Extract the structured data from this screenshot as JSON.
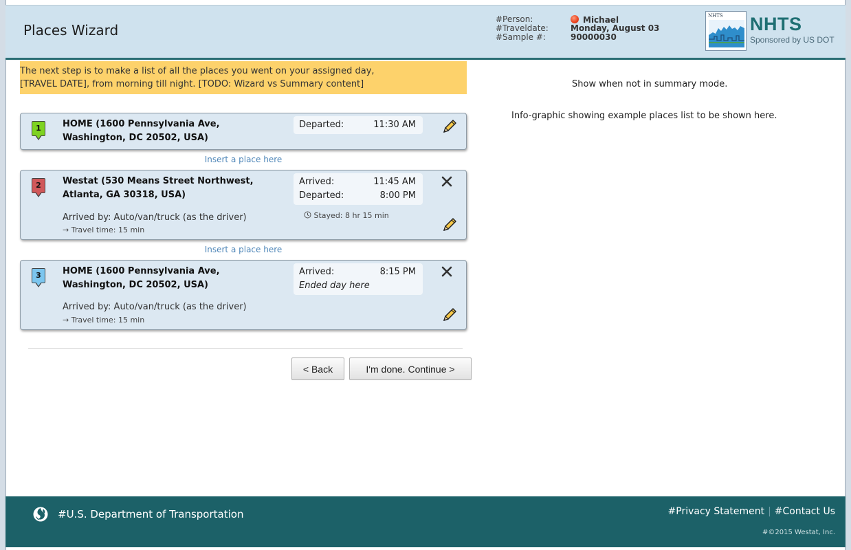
{
  "header": {
    "title": "Places Wizard",
    "meta_labels": [
      "#Person:",
      "#Traveldate:",
      "#Sample #:"
    ],
    "person": "Michael",
    "travel_date": "Monday, August 03",
    "sample": "90000030",
    "logo_small": "NHTS",
    "brand": "NHTS",
    "brand_sub": "Sponsored by US DOT"
  },
  "banner": {
    "line1": "The next step is to make a list of all the places you went on your assigned day,",
    "line2": "[TRAVEL DATE], from morning till night.   [TODO: Wizard vs Summary content]"
  },
  "places": [
    {
      "number": "1",
      "name_line1": "HOME (1600 Pennsylvania Ave,",
      "name_line2": "Washington, DC 20502, USA)",
      "departed_label": "Departed:",
      "departed_time": "11:30 AM",
      "marker_color": "#7ed321"
    },
    {
      "number": "2",
      "name_line1": "Westat (530 Means Street Northwest,",
      "name_line2": "Atlanta, GA 30318, USA)",
      "arrived_label": "Arrived:",
      "arrived_time": "11:45 AM",
      "departed_label": "Departed:",
      "departed_time": "8:00 PM",
      "stayed": "Stayed: 8 hr 15 min",
      "arrived_by": "Arrived by: Auto/van/truck (as the driver)",
      "travel_time": "Travel time: 15 min",
      "marker_color": "#d0585a"
    },
    {
      "number": "3",
      "name_line1": "HOME (1600 Pennsylvania Ave,",
      "name_line2": "Washington, DC 20502, USA)",
      "arrived_label": "Arrived:",
      "arrived_time": "8:15 PM",
      "ended": "Ended day here",
      "arrived_by": "Arrived by: Auto/van/truck (as the driver)",
      "travel_time": "Travel time: 15 min",
      "marker_color": "#7cc6ef"
    }
  ],
  "insert_label": "Insert a place here",
  "buttons": {
    "back": "< Back",
    "continue": "I'm done. Continue >"
  },
  "side": {
    "line1": "Show when not in summary mode.",
    "line2": "Info-graphic showing example places list to be shown here."
  },
  "footer": {
    "department": "#U.S. Department of Transportation",
    "privacy": "#Privacy Statement",
    "contact": "#Contact Us",
    "copyright": "#©2015 Westat, Inc."
  },
  "icons": {
    "marker": "map-marker-icon",
    "edit": "pencil-icon",
    "delete": "x-icon",
    "clock": "clock-icon",
    "arrow": "right-arrow-icon",
    "person_status": "red-dot-icon",
    "dot_logo": "dot-logo-icon"
  },
  "colors": {
    "header_bg": "#cfe2ee",
    "banner_bg": "#fdd26b",
    "card_bg": "#dce8f2",
    "footer_bg": "#1c6168",
    "brand": "#1f6f73",
    "link": "#4e86b8"
  }
}
